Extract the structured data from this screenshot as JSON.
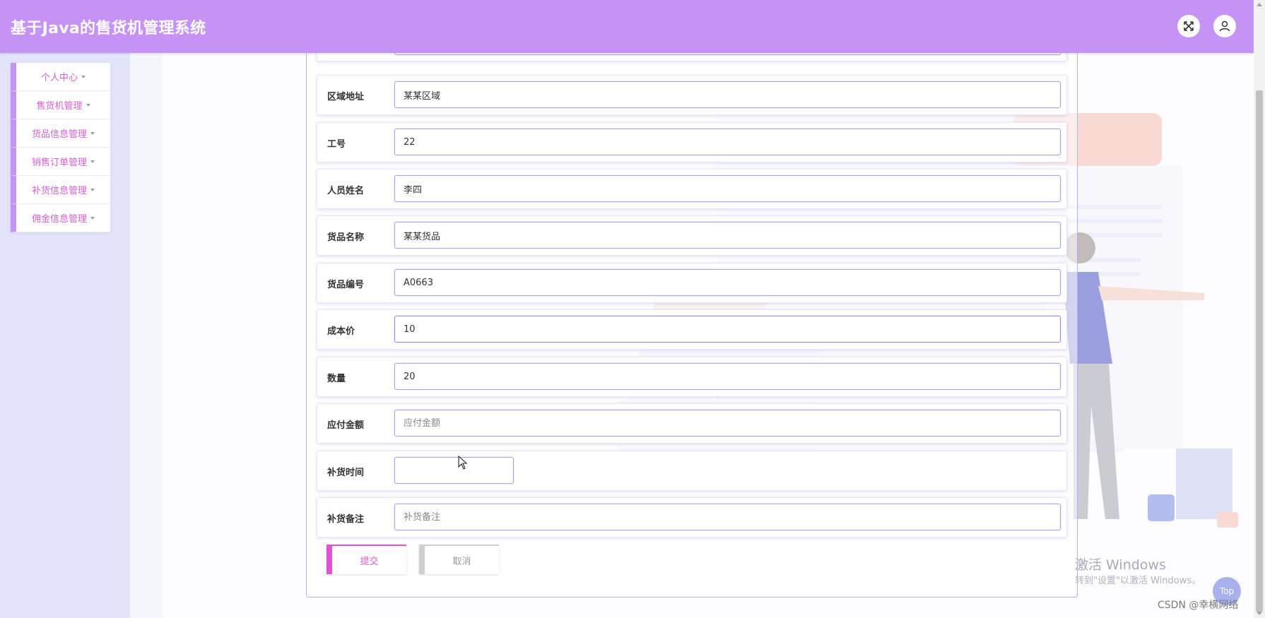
{
  "header": {
    "title": "基于Java的售货机管理系统"
  },
  "sidebar": {
    "items": [
      {
        "label": "个人中心"
      },
      {
        "label": "售货机管理"
      },
      {
        "label": "货品信息管理"
      },
      {
        "label": "销售订单管理"
      },
      {
        "label": "补货信息管理"
      },
      {
        "label": "佣金信息管理"
      }
    ]
  },
  "form": {
    "fields": [
      {
        "label": "区域地址",
        "value": "某某区域",
        "placeholder": ""
      },
      {
        "label": "工号",
        "value": "22",
        "placeholder": ""
      },
      {
        "label": "人员姓名",
        "value": "李四",
        "placeholder": ""
      },
      {
        "label": "货品名称",
        "value": "某某货品",
        "placeholder": ""
      },
      {
        "label": "货品编号",
        "value": "A0663",
        "placeholder": ""
      },
      {
        "label": "成本价",
        "value": "10",
        "placeholder": ""
      },
      {
        "label": "数量",
        "value": "20",
        "placeholder": ""
      },
      {
        "label": "应付金额",
        "value": "",
        "placeholder": "应付金额"
      },
      {
        "label": "补货时间",
        "value": "",
        "placeholder": ""
      },
      {
        "label": "补货备注",
        "value": "",
        "placeholder": "补货备注"
      }
    ],
    "submit_label": "提交",
    "cancel_label": "取消"
  },
  "overlay": {
    "activate_title": "激活 Windows",
    "activate_subtitle": "转到\"设置\"以激活 Windows。",
    "csdn": "CSDN @幸横网络",
    "top_label": "Top"
  },
  "colors": {
    "header": "#c493f5",
    "accent": "#d45fd0",
    "sidebar_bg": "#e3e3fb",
    "field_border": "#a9a6e8"
  }
}
